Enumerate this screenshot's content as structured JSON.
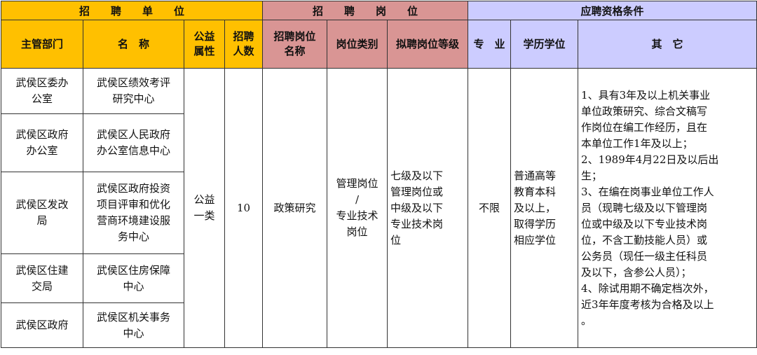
{
  "groups": {
    "unit": "招　　聘　　单　　位",
    "post": "招　　聘　　岗　　位",
    "qual": "应聘资格条件"
  },
  "headers": {
    "dept": "主管部门",
    "name": "名　称",
    "welfare": [
      "公益",
      "属性"
    ],
    "count": [
      "招聘",
      "人数"
    ],
    "post_name": [
      "招聘岗位",
      "名称"
    ],
    "post_type": "岗位类别",
    "post_level": "拟聘岗位等级",
    "major": "专　业",
    "edu": "学历学位",
    "other": "其　它"
  },
  "rows": [
    {
      "dept": [
        "武侯区委办",
        "公室"
      ],
      "name": [
        "武侯区绩效考评",
        "研究中心"
      ]
    },
    {
      "dept": [
        "武侯区政府",
        "办公室"
      ],
      "name": [
        "武侯区人民政府",
        "办公室信息中心"
      ]
    },
    {
      "dept": [
        "武侯区发改",
        "局"
      ],
      "name": [
        "武侯区政府投资",
        "项目评审和优化",
        "营商环境建设服",
        "务中心"
      ]
    },
    {
      "dept": [
        "武侯区住建",
        "交局"
      ],
      "name": [
        "武侯区住房保障",
        "中心"
      ]
    },
    {
      "dept": [
        "武侯区政府"
      ],
      "name": [
        "武侯区机关事务",
        "中心"
      ]
    }
  ],
  "shared": {
    "welfare": [
      "公益",
      "一类"
    ],
    "count": "10",
    "post_name": "政策研究",
    "post_type": [
      "管理岗位",
      "/",
      "专业技术",
      "岗位"
    ],
    "post_level": [
      "七级及以下",
      "管理岗位或",
      "中级及以下",
      "专业技术岗",
      "位"
    ],
    "major": "不限",
    "edu": [
      "普通高等",
      "教育本科",
      "及以上，",
      "取得学历",
      "相应学位"
    ],
    "other": [
      "1、具有3年及以上机关事业",
      "单位政策研究、综合文稿写",
      "作岗位在编工作经历，且在",
      "本单位工作1年及以上；",
      "2、1989年4月22日及以后出",
      "生；",
      "3、在编在岗事业单位工作人",
      "员（现聘七级及以下管理岗",
      "位或中级及以下专业技术岗",
      "位，不含工勤技能人员）或",
      "公务员（现任一级主任科员",
      "及以下，含参公人员）；",
      "4、除试用期不确定档次外，",
      "近3年年度考核为合格及以上",
      "。"
    ]
  },
  "colors": {
    "unit_header": "#ffc000",
    "post_header": "#d99594",
    "qual_header": "#ccccff"
  }
}
